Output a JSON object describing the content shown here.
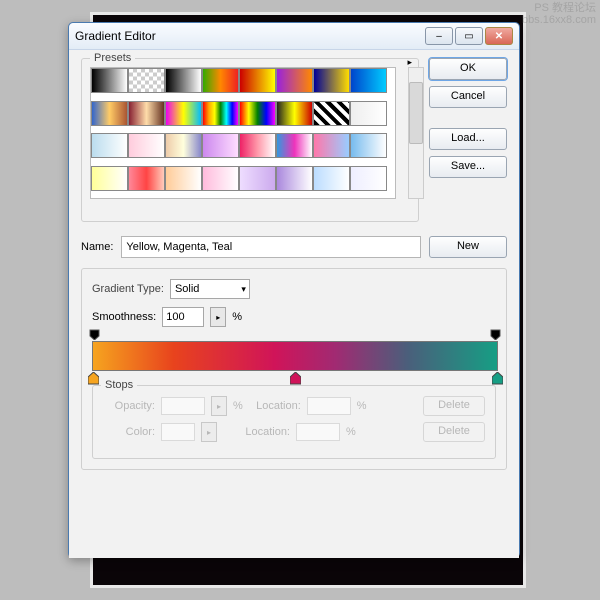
{
  "watermark": {
    "line1": "PS 教程论坛",
    "line2": "bbs.16xx8.com"
  },
  "window": {
    "title": "Gradient Editor"
  },
  "buttons": {
    "ok": "OK",
    "cancel": "Cancel",
    "load": "Load...",
    "save": "Save...",
    "new": "New",
    "delete": "Delete"
  },
  "presets": {
    "legend": "Presets"
  },
  "name": {
    "label": "Name:",
    "value": "Yellow, Magenta, Teal"
  },
  "gradtype": {
    "label": "Gradient Type:",
    "value": "Solid"
  },
  "smoothness": {
    "label": "Smoothness:",
    "value": "100",
    "unit": "%"
  },
  "stops": {
    "legend": "Stops",
    "opacity": {
      "label": "Opacity:",
      "unit": "%"
    },
    "location1": {
      "label": "Location:",
      "unit": "%"
    },
    "color": {
      "label": "Color:"
    },
    "location2": {
      "label": "Location:",
      "unit": "%"
    }
  },
  "swatches": [
    "linear-gradient(90deg,#000,#fff)",
    "repeating-conic-gradient(#ccc 0 25%,#fff 0 50%) 0/8px 8px",
    "linear-gradient(90deg,#000,#fff)",
    "linear-gradient(90deg,#3a0,#f80,#e22)",
    "linear-gradient(90deg,#c00,#ff0)",
    "linear-gradient(90deg,#92d,#f80)",
    "linear-gradient(90deg,#009,#fd0)",
    "linear-gradient(90deg,#04c,#0cf)",
    "linear-gradient(90deg,#36c,#fc6,#a53)",
    "linear-gradient(90deg,#823,#fda,#632)",
    "linear-gradient(90deg,#e0e,#ff0,#0bf)",
    "linear-gradient(90deg,red,orange,yellow,green,cyan,blue,magenta)",
    "linear-gradient(90deg,red,yellow,green,blue,magenta)",
    "linear-gradient(90deg,#222,#ff0,#c00)",
    "repeating-linear-gradient(45deg,#000 0 4px,#fff 4px 8px)",
    "linear-gradient(90deg,#eee,#fff)",
    "linear-gradient(90deg,#bde,#fff)",
    "linear-gradient(90deg,#fcd,#fff)",
    "linear-gradient(90deg,#eca,#ffd,#88c)",
    "linear-gradient(90deg,#c8e,#fdf)",
    "linear-gradient(90deg,#e26,#f9a,#fff)",
    "linear-gradient(90deg,#39d,#e3b,#fff)",
    "linear-gradient(90deg,#f7a,#9cf)",
    "linear-gradient(90deg,#7be,#fff)",
    "linear-gradient(90deg,#ff9,#fff)",
    "linear-gradient(90deg,#f89,#f44,#fcb)",
    "linear-gradient(90deg,#fc9,#fff)",
    "linear-gradient(90deg,#fbd,#fff)",
    "linear-gradient(90deg,#edf,#cae)",
    "linear-gradient(90deg,#a8d,#fff)",
    "linear-gradient(90deg,#bdf,#fff)",
    "linear-gradient(90deg,#eef,#fff)"
  ],
  "colorstops": [
    {
      "pos": 0,
      "fill": "#f6a41f"
    },
    {
      "pos": 50,
      "fill": "#d01459"
    },
    {
      "pos": 100,
      "fill": "#169e84"
    }
  ]
}
